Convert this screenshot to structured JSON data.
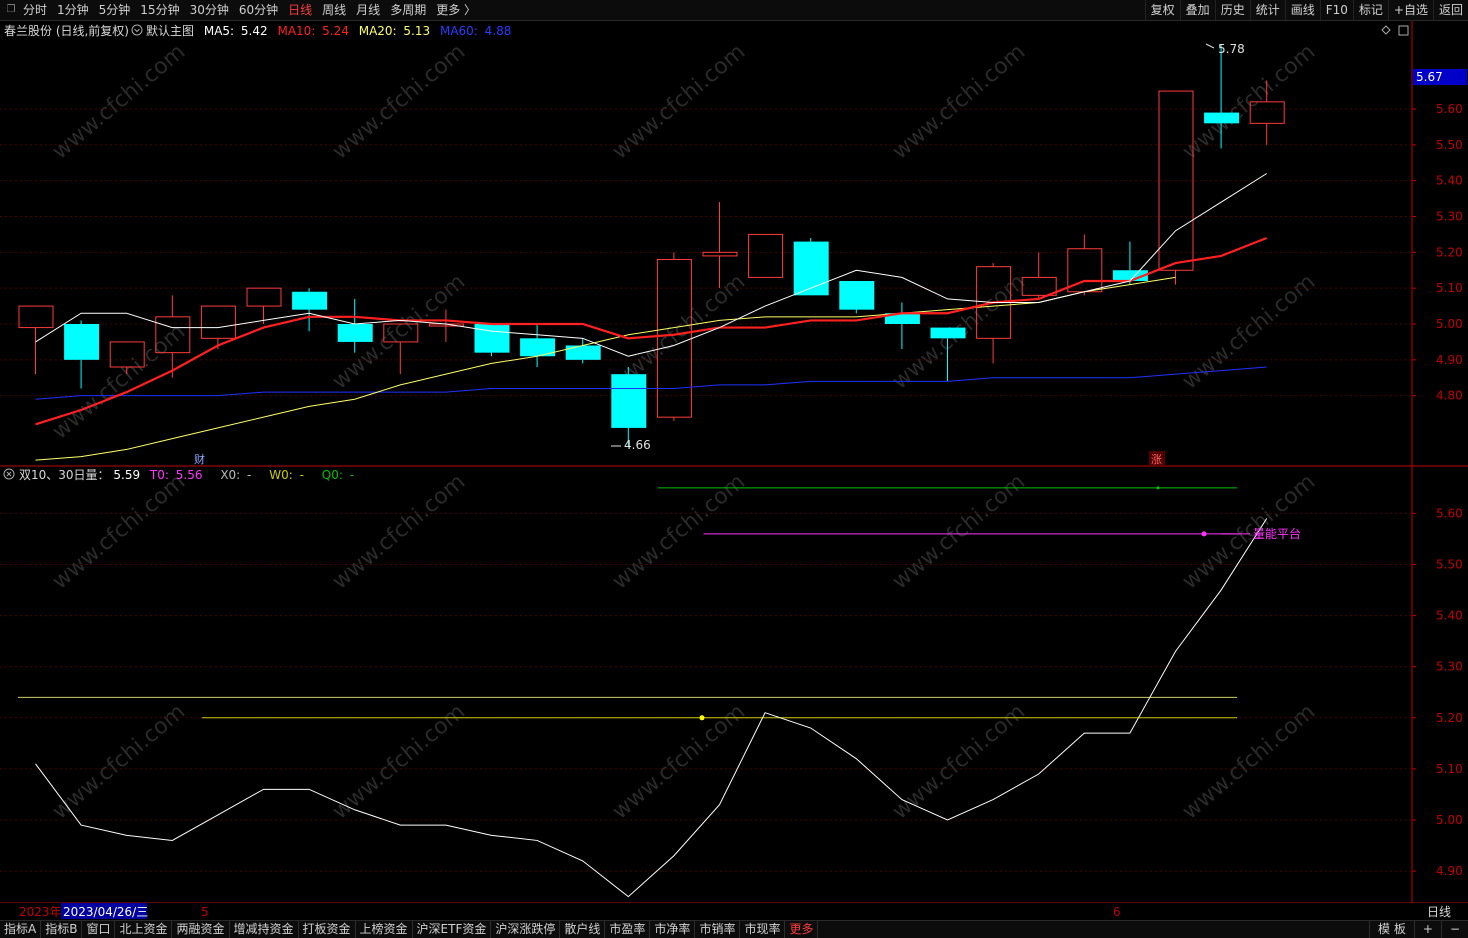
{
  "topbar": {
    "window_icon": "restore-icon",
    "periods": [
      "分时",
      "1分钟",
      "5分钟",
      "15分钟",
      "30分钟",
      "60分钟",
      "日线",
      "周线",
      "月线",
      "多周期",
      "更多 〉"
    ],
    "active_period": "日线",
    "actions": [
      "复权",
      "叠加",
      "历史",
      "统计",
      "画线",
      "F10",
      "标记",
      "+自选",
      "返回"
    ]
  },
  "main_header": {
    "stock": "春兰股份 (日线,前复权)",
    "template_icon": "dropdown-circle-icon",
    "template": "默认主图",
    "ma5_label": "MA5:",
    "ma5": "5.42",
    "ma10_label": "MA10:",
    "ma10": "5.24",
    "ma20_label": "MA20:",
    "ma20": "5.13",
    "ma60_label": "MA60:",
    "ma60": "4.88",
    "right_icons": [
      "diamond-icon",
      "panel-icon"
    ]
  },
  "sub_header": {
    "close_icon": "close-circle-icon",
    "name": "双10、30日量：",
    "value": "5.59",
    "t0_label": "T0:",
    "t0": "5.56",
    "x0_label": "X0:",
    "x0": "-",
    "w0_label": "W0:",
    "w0": "-",
    "q0_label": "Q0:",
    "q0": "-"
  },
  "annotations": {
    "high": "5.78",
    "low": "4.66",
    "current_price": "5.67",
    "cai_marker": "财",
    "zhang_marker": "涨",
    "platform": "量能平台",
    "watermark": "www.cfchi.com"
  },
  "time_axis": {
    "year": "2023年",
    "cursor_date": "2023/04/26/三",
    "m5": "5",
    "m6": "6",
    "period": "日线"
  },
  "colors": {
    "up": "#ff3b3b",
    "down": "#00ffff",
    "ma5": "#ffffff",
    "ma10": "#ff2020",
    "ma20": "#ffff66",
    "ma60": "#1e32ff",
    "grid": "#4a0000",
    "axis": "#c00000"
  },
  "chart_data": [
    {
      "type": "candlestick",
      "ylim": [
        4.64,
        5.82
      ],
      "y_ticks": [
        4.8,
        4.9,
        5.0,
        5.1,
        5.2,
        5.3,
        5.4,
        5.5,
        5.6
      ],
      "candles": [
        {
          "o": 4.99,
          "h": 5.05,
          "l": 4.86,
          "c": 5.05
        },
        {
          "o": 5.0,
          "h": 5.01,
          "l": 4.82,
          "c": 4.9
        },
        {
          "o": 4.88,
          "h": 4.95,
          "l": 4.86,
          "c": 4.95
        },
        {
          "o": 4.92,
          "h": 5.08,
          "l": 4.85,
          "c": 5.02
        },
        {
          "o": 4.96,
          "h": 5.05,
          "l": 4.93,
          "c": 5.05
        },
        {
          "o": 5.05,
          "h": 5.1,
          "l": 5.0,
          "c": 5.1
        },
        {
          "o": 5.09,
          "h": 5.1,
          "l": 4.98,
          "c": 5.04
        },
        {
          "o": 5.0,
          "h": 5.07,
          "l": 4.92,
          "c": 4.95
        },
        {
          "o": 4.95,
          "h": 5.0,
          "l": 4.86,
          "c": 5.0
        },
        {
          "o": 5.0,
          "h": 5.04,
          "l": 4.95,
          "c": 5.0
        },
        {
          "o": 5.0,
          "h": 5.0,
          "l": 4.91,
          "c": 4.92
        },
        {
          "o": 4.96,
          "h": 5.0,
          "l": 4.88,
          "c": 4.91
        },
        {
          "o": 4.94,
          "h": 4.96,
          "l": 4.89,
          "c": 4.9
        },
        {
          "o": 4.86,
          "h": 4.88,
          "l": 4.66,
          "c": 4.71
        },
        {
          "o": 4.74,
          "h": 5.2,
          "l": 4.73,
          "c": 5.18
        },
        {
          "o": 5.19,
          "h": 5.34,
          "l": 5.1,
          "c": 5.2
        },
        {
          "o": 5.13,
          "h": 5.25,
          "l": 5.13,
          "c": 5.25
        },
        {
          "o": 5.23,
          "h": 5.24,
          "l": 5.08,
          "c": 5.08
        },
        {
          "o": 5.12,
          "h": 5.12,
          "l": 5.03,
          "c": 5.04
        },
        {
          "o": 5.03,
          "h": 5.06,
          "l": 4.93,
          "c": 5.0
        },
        {
          "o": 4.99,
          "h": 4.99,
          "l": 4.84,
          "c": 4.96
        },
        {
          "o": 4.96,
          "h": 5.17,
          "l": 4.89,
          "c": 5.16
        },
        {
          "o": 5.08,
          "h": 5.2,
          "l": 5.07,
          "c": 5.13
        },
        {
          "o": 5.09,
          "h": 5.25,
          "l": 5.08,
          "c": 5.21
        },
        {
          "o": 5.15,
          "h": 5.23,
          "l": 5.11,
          "c": 5.12
        },
        {
          "o": 5.15,
          "h": 5.65,
          "l": 5.11,
          "c": 5.65
        },
        {
          "o": 5.59,
          "h": 5.78,
          "l": 5.49,
          "c": 5.56
        },
        {
          "o": 5.56,
          "h": 5.68,
          "l": 5.5,
          "c": 5.62
        }
      ],
      "ma5": [
        4.95,
        5.03,
        5.03,
        4.99,
        4.99,
        5.01,
        5.03,
        5.0,
        5.01,
        5.0,
        4.98,
        4.97,
        4.96,
        4.91,
        4.94,
        4.99,
        5.05,
        5.1,
        5.15,
        5.13,
        5.07,
        5.06,
        5.06,
        5.09,
        5.12,
        5.26,
        5.34,
        5.42
      ],
      "ma10": [
        4.72,
        4.76,
        4.81,
        4.87,
        4.94,
        4.99,
        5.02,
        5.02,
        5.01,
        5.01,
        5.0,
        5.0,
        5.0,
        4.96,
        4.97,
        4.99,
        4.99,
        5.01,
        5.01,
        5.03,
        5.03,
        5.06,
        5.07,
        5.12,
        5.12,
        5.17,
        5.19,
        5.24
      ],
      "ma20": [
        4.62,
        4.63,
        4.65,
        4.68,
        4.71,
        4.74,
        4.77,
        4.79,
        4.83,
        4.86,
        4.89,
        4.91,
        4.94,
        4.97,
        4.99,
        5.01,
        5.02,
        5.02,
        5.02,
        5.03,
        5.04,
        5.05,
        5.06,
        5.09,
        5.11,
        5.13
      ],
      "ma60": [
        4.79,
        4.8,
        4.8,
        4.8,
        4.8,
        4.81,
        4.81,
        4.81,
        4.81,
        4.81,
        4.82,
        4.82,
        4.82,
        4.82,
        4.82,
        4.83,
        4.83,
        4.84,
        4.84,
        4.84,
        4.84,
        4.85,
        4.85,
        4.85,
        4.85,
        4.86,
        4.87,
        4.88
      ]
    },
    {
      "type": "line",
      "name": "双10、30日量",
      "ylim": [
        4.84,
        5.7
      ],
      "y_ticks": [
        4.9,
        5.0,
        5.1,
        5.2,
        5.3,
        5.4,
        5.5,
        5.6
      ],
      "values": [
        5.11,
        4.99,
        4.97,
        4.96,
        5.01,
        5.06,
        5.06,
        5.02,
        4.99,
        4.99,
        4.97,
        4.96,
        4.92,
        4.85,
        4.93,
        5.03,
        5.21,
        5.18,
        5.12,
        5.04,
        5.0,
        5.04,
        5.09,
        5.17,
        5.17,
        5.33,
        5.45,
        5.59
      ],
      "hlines": [
        {
          "value": 5.65,
          "from": 14,
          "to": 26,
          "color": "#00c000"
        },
        {
          "value": 5.56,
          "from": 15,
          "to": 26,
          "color": "#ff33ff"
        },
        {
          "value": 5.24,
          "from": 0,
          "to": 26,
          "color": "#cccc66"
        },
        {
          "value": 5.2,
          "from": 4,
          "to": 26,
          "color": "#cccc00"
        }
      ]
    }
  ]
}
